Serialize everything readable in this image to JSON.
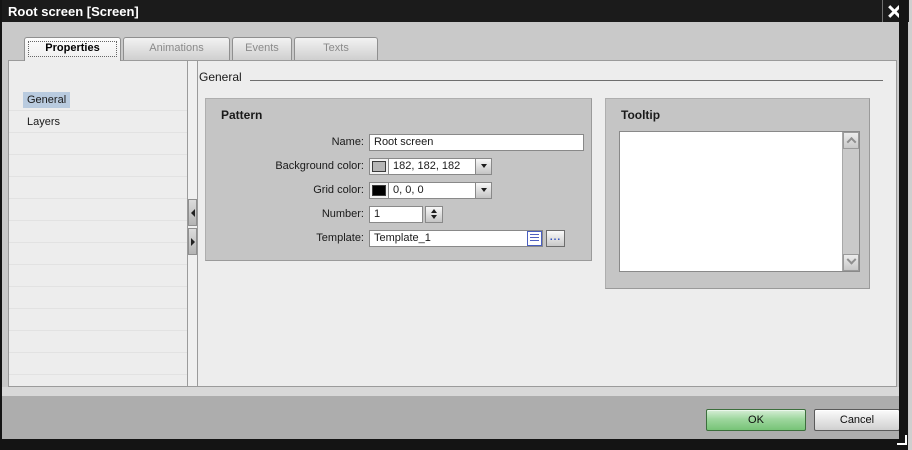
{
  "window": {
    "title": "Root screen [Screen]"
  },
  "tabs": [
    {
      "label": "Properties",
      "active": true
    },
    {
      "label": "Animations",
      "active": false
    },
    {
      "label": "Events",
      "active": false
    },
    {
      "label": "Texts",
      "active": false
    }
  ],
  "sidebar": {
    "items": [
      {
        "label": "General",
        "selected": true
      },
      {
        "label": "Layers",
        "selected": false
      }
    ]
  },
  "main": {
    "section_title": "General",
    "pattern": {
      "title": "Pattern",
      "name_label": "Name:",
      "name_value": "Root screen",
      "background_color_label": "Background color:",
      "background_color_value": "182, 182, 182",
      "background_color_hex": "#b6b6b6",
      "grid_color_label": "Grid color:",
      "grid_color_value": "0, 0, 0",
      "grid_color_hex": "#000000",
      "number_label": "Number:",
      "number_value": "1",
      "template_label": "Template:",
      "template_value": "Template_1",
      "browse_label": "..."
    },
    "tooltip": {
      "title": "Tooltip",
      "value": ""
    }
  },
  "footer": {
    "ok_label": "OK",
    "cancel_label": "Cancel"
  },
  "colors": {
    "selection_blue": "#b9cbdf",
    "ok_green": "#77c377",
    "titlebar_black": "#1b1b1b"
  }
}
